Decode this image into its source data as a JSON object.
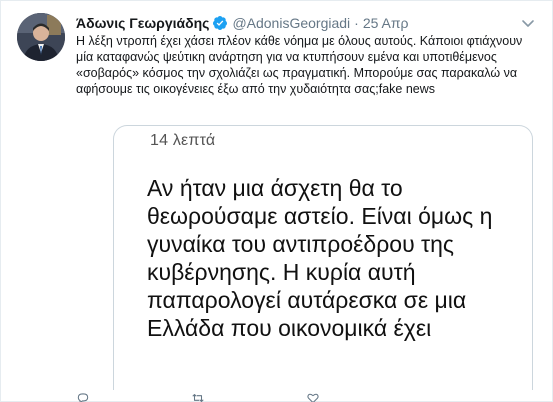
{
  "tweet": {
    "display_name": "Άδωνις Γεωργιάδης",
    "handle": "@AdonisGeorgiadi",
    "separator": "·",
    "date": "25 Απρ",
    "text": "Η λέξη ντροπή έχει χάσει πλέον κάθε νόημα με όλους αυτούς. Κάποιοι φτιάχνουν μία καταφανώς ψεύτικη ανάρτηση για να κτυπήσουν εμένα και υποτιθέμενος «σοβαρός» κόσμος την σχολιάζει ως πραγματική. Μπορούμε σας παρακαλώ να αφήσουμε τις οικογένειες έξω από την χυδαιότητα σας;fake news"
  },
  "media": {
    "time_label": "14 λεπτά",
    "body_text": "Αν ήταν μια άσχετη θα το θεωρούσαμε αστείο. Είναι όμως η γυναίκα του αντιπροέδρου της κυβέρνησης. Η κυρία αυτή παπαρολογεί αυτάρεσκα σε μια Ελλάδα που οικονομικά έχει"
  },
  "icons": {
    "verified": "verified-badge-icon",
    "caret": "chevron-down-icon",
    "reply": "reply-icon",
    "retweet": "retweet-icon",
    "like": "heart-icon"
  },
  "colors": {
    "verified": "#1da1f2",
    "secondary_text": "#657786",
    "primary_text": "#14171a",
    "border": "#e6ecf0"
  }
}
